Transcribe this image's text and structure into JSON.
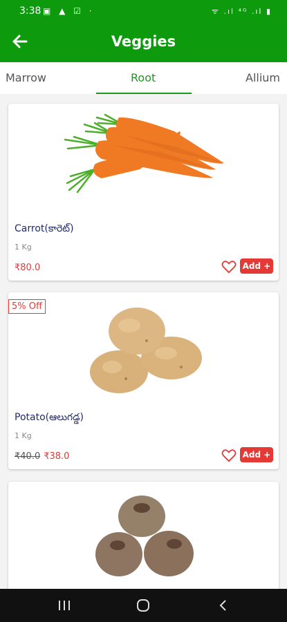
{
  "status_bar": {
    "time": "3:38",
    "left_icons": "▣ ▲ ☑ ·",
    "right_icons": "ᯤ .ıl ⁴ᴳ .ıl ▮"
  },
  "app_bar": {
    "title": "Veggies"
  },
  "tabs": [
    {
      "label": "Marrow",
      "active": false
    },
    {
      "label": "Root",
      "active": true
    },
    {
      "label": "Allium",
      "active": false
    }
  ],
  "products": [
    {
      "name": "Carrot(కారెట్)",
      "qty": "1 Kg",
      "price": "₹80.0",
      "add_label": "Add +",
      "image": "carrot-image"
    },
    {
      "name": "Potato(ఆలుగడ్డ)",
      "qty": "1 Kg",
      "old_price": "₹40.0",
      "price": "₹38.0",
      "badge": "5% Off",
      "add_label": "Add +",
      "image": "potato-image"
    },
    {
      "image": "beetroot-image"
    }
  ],
  "colors": {
    "primary": "#0d9a0d",
    "accent": "#e53935",
    "name_text": "#202a6a"
  },
  "nav_bar": {
    "icons": [
      "recents-icon",
      "home-icon",
      "back-nav-icon"
    ]
  }
}
